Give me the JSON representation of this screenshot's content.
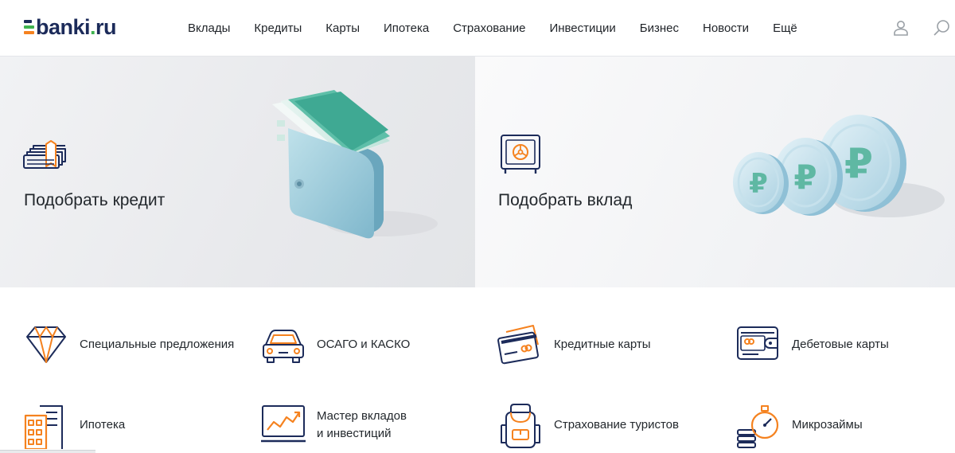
{
  "header": {
    "logo": {
      "main": "banki",
      "dot": ".",
      "tld": "ru"
    },
    "nav": [
      "Вклады",
      "Кредиты",
      "Карты",
      "Ипотека",
      "Страхование",
      "Инвестиции",
      "Бизнес",
      "Новости",
      "Ещё"
    ],
    "icons": {
      "user": "user-icon",
      "search": "search-icon"
    }
  },
  "hero": {
    "credit": {
      "title": "Подобрать кредит",
      "icon": "banknotes-icon"
    },
    "deposit": {
      "title": "Подобрать вклад",
      "icon": "safe-icon"
    }
  },
  "products": [
    {
      "label": "Специальные предложения",
      "icon": "diamond-icon"
    },
    {
      "label": "ОСАГО и КАСКО",
      "icon": "car-icon"
    },
    {
      "label": "Кредитные карты",
      "icon": "credit-cards-icon"
    },
    {
      "label": "Дебетовые карты",
      "icon": "wallet-card-icon"
    },
    {
      "label": "Ипотека",
      "icon": "building-icon"
    },
    {
      "label": "Мастер вкладов и инвестиций",
      "line1": "Мастер вкладов",
      "line2": "и инвестиций",
      "icon": "growth-chart-icon"
    },
    {
      "label": "Страхование туристов",
      "icon": "backpack-icon"
    },
    {
      "label": "Микрозаймы",
      "icon": "stopwatch-coins-icon"
    }
  ],
  "colors": {
    "brand_dark": "#1c2b5a",
    "accent_orange": "#f5821f",
    "accent_green": "#3fb34f",
    "teal": "#7cc9c1"
  }
}
